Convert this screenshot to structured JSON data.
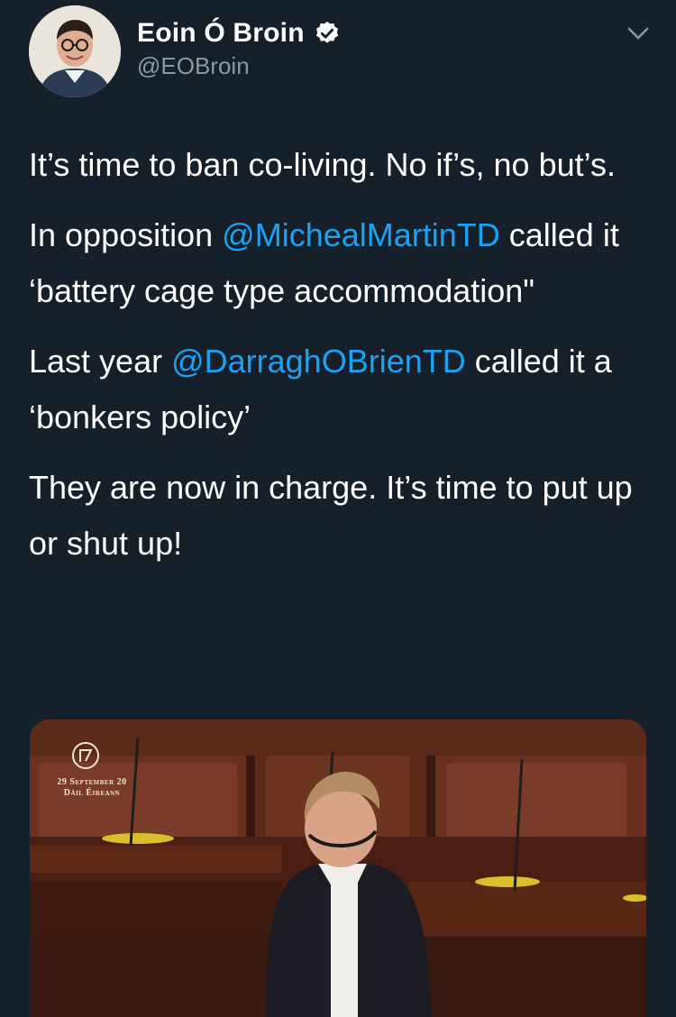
{
  "author": {
    "name": "Eoin Ó Broin",
    "handle": "@EOBroin",
    "verified": true
  },
  "icons": {
    "verified": "verified-badge-icon",
    "menu": "chevron-down-icon",
    "media_logo": "oireachtas-harp-logo"
  },
  "tweet": {
    "p1": "It’s time to ban co-living. No if’s, no but’s.",
    "p2_a": "In opposition ",
    "p2_mention": "@MichealMartinTD",
    "p2_b": " called it ‘battery cage type accommodation\"",
    "p3_a": "Last year ",
    "p3_mention": "@DarraghOBrienTD",
    "p3_b": " called it a ‘bonkers policy’",
    "p4": "They are now in charge. It’s time to put up or shut up!"
  },
  "media": {
    "date_line": "29 September 20",
    "place_line": "Dáil Éireann"
  },
  "colors": {
    "background": "#15202b",
    "link": "#1da1f2",
    "secondary_text": "#8899a6"
  }
}
